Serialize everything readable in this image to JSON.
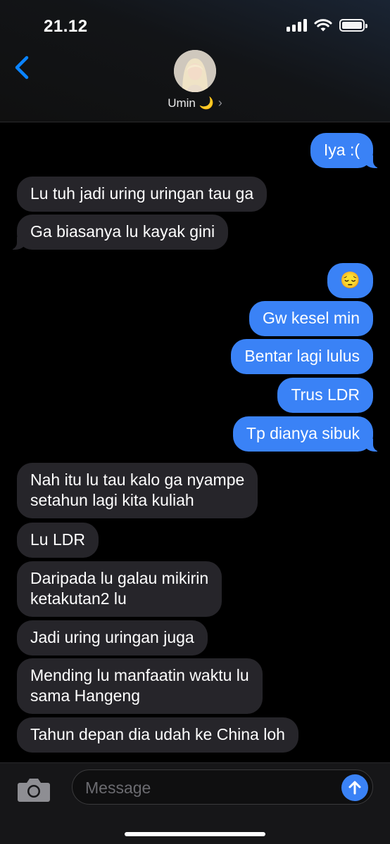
{
  "status_bar": {
    "time": "21.12",
    "icons": [
      "cellular-signal-icon",
      "wifi-icon",
      "battery-icon"
    ]
  },
  "header": {
    "back_icon": "chevron-left-icon",
    "contact_name": "Umin 🌙",
    "details_chevron": "›"
  },
  "messages": [
    {
      "side": "sent",
      "text": "Iya :("
    },
    {
      "side": "received",
      "text": "Lu tuh jadi uring uringan tau ga"
    },
    {
      "side": "received",
      "text": "Ga biasanya lu kayak gini"
    },
    {
      "side": "sent",
      "text": "😔"
    },
    {
      "side": "sent",
      "text": "Gw kesel min"
    },
    {
      "side": "sent",
      "text": "Bentar lagi lulus"
    },
    {
      "side": "sent",
      "text": "Trus LDR"
    },
    {
      "side": "sent",
      "text": "Tp dianya sibuk"
    },
    {
      "side": "received",
      "text": "Nah itu lu tau kalo ga nyampe\nsetahun lagi kita kuliah"
    },
    {
      "side": "received",
      "text": "Lu LDR"
    },
    {
      "side": "received",
      "text": "Daripada lu galau mikirin\nketakutan2 lu"
    },
    {
      "side": "received",
      "text": "Jadi uring uringan juga"
    },
    {
      "side": "received",
      "text": "Mending lu manfaatin waktu lu\nsama Hangeng"
    },
    {
      "side": "received",
      "text": "Tahun depan dia udah ke China loh"
    }
  ],
  "composer": {
    "camera_icon": "camera-icon",
    "placeholder": "Message",
    "value": "",
    "send_icon": "arrow-up-icon"
  },
  "colors": {
    "sent_bubble": "#3a82f6",
    "received_bubble": "#26252a",
    "accent": "#0a84ff"
  }
}
